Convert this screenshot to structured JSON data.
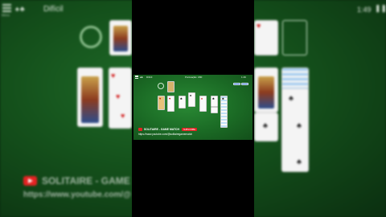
{
  "background_game": {
    "menu_label": "Menu",
    "suit_icons": "♠♣",
    "difficulty": "Difícil",
    "time": "1:49",
    "pause_symbol": "❚❚"
  },
  "watermark": {
    "channel": "SOLITAIRE - GAME MA",
    "url": "https://www.youtube.com/@"
  },
  "inner_game": {
    "suit_icons": "♠♣",
    "difficulty": "Difícil",
    "score_label": "Pontuação: 1B0",
    "time": "1:49",
    "channel": "SOLITAIRE - GAME MATCH",
    "subscribe": "SUBSCRIBE",
    "url": "https://www.youtube.com/@solitairegamematch"
  },
  "colors": {
    "felt": "#1b6b25",
    "card_back": "#2e6fc7",
    "youtube_red": "#e52222"
  }
}
